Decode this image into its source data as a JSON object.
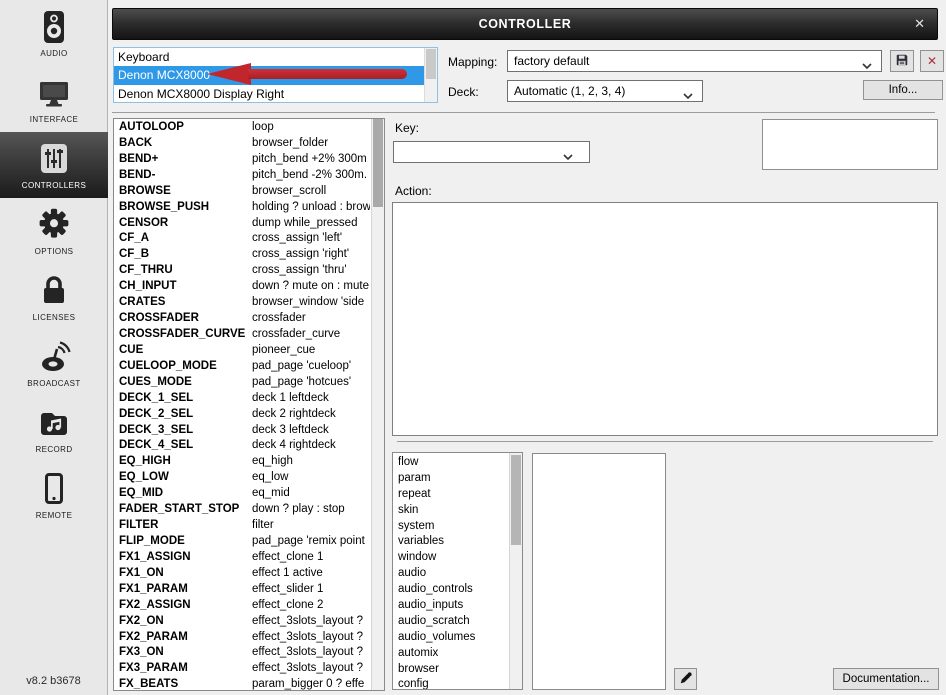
{
  "window": {
    "title": "CONTROLLER",
    "close_glyph": "✕"
  },
  "sidebar": {
    "items": [
      {
        "label": "AUDIO",
        "icon": "speaker-icon",
        "selected": false
      },
      {
        "label": "INTERFACE",
        "icon": "monitor-icon",
        "selected": false
      },
      {
        "label": "CONTROLLERS",
        "icon": "sliders-icon",
        "selected": true
      },
      {
        "label": "OPTIONS",
        "icon": "gear-icon",
        "selected": false
      },
      {
        "label": "LICENSES",
        "icon": "lock-icon",
        "selected": false
      },
      {
        "label": "BROADCAST",
        "icon": "broadcast-icon",
        "selected": false
      },
      {
        "label": "RECORD",
        "icon": "folder-music-icon",
        "selected": false
      },
      {
        "label": "REMOTE",
        "icon": "smartphone-icon",
        "selected": false
      }
    ],
    "version": "v8.2 b3678"
  },
  "devices": {
    "items": [
      "Keyboard",
      "Denon MCX8000",
      "Denon MCX8000 Display Right"
    ],
    "selected_index": 1
  },
  "header": {
    "mapping_label": "Mapping:",
    "mapping_value": "factory default",
    "deck_label": "Deck:",
    "deck_value": "Automatic (1, 2, 3, 4)",
    "info_button": "Info..."
  },
  "key_panel": {
    "key_label": "Key:",
    "key_value": "",
    "action_label": "Action:",
    "action_value": "",
    "display_value": ""
  },
  "bindings": [
    {
      "key": "AUTOLOOP",
      "action": "loop"
    },
    {
      "key": "BACK",
      "action": "browser_folder"
    },
    {
      "key": "BEND+",
      "action": "pitch_bend +2% 300m"
    },
    {
      "key": "BEND-",
      "action": "pitch_bend -2% 300m."
    },
    {
      "key": "BROWSE",
      "action": "browser_scroll"
    },
    {
      "key": "BROWSE_PUSH",
      "action": "holding ? unload : brow"
    },
    {
      "key": "CENSOR",
      "action": "dump while_pressed"
    },
    {
      "key": "CF_A",
      "action": "cross_assign 'left'"
    },
    {
      "key": "CF_B",
      "action": "cross_assign 'right'"
    },
    {
      "key": "CF_THRU",
      "action": "cross_assign 'thru'"
    },
    {
      "key": "CH_INPUT",
      "action": "down ? mute on : mute"
    },
    {
      "key": "CRATES",
      "action": "browser_window 'side"
    },
    {
      "key": "CROSSFADER",
      "action": "crossfader"
    },
    {
      "key": "CROSSFADER_CURVE",
      "action": "crossfader_curve"
    },
    {
      "key": "CUE",
      "action": "pioneer_cue"
    },
    {
      "key": "CUELOOP_MODE",
      "action": "pad_page 'cueloop'"
    },
    {
      "key": "CUES_MODE",
      "action": "pad_page 'hotcues'"
    },
    {
      "key": "DECK_1_SEL",
      "action": "deck 1 leftdeck"
    },
    {
      "key": "DECK_2_SEL",
      "action": "deck 2 rightdeck"
    },
    {
      "key": "DECK_3_SEL",
      "action": "deck 3 leftdeck"
    },
    {
      "key": "DECK_4_SEL",
      "action": "deck 4 rightdeck"
    },
    {
      "key": "EQ_HIGH",
      "action": "eq_high"
    },
    {
      "key": "EQ_LOW",
      "action": "eq_low"
    },
    {
      "key": "EQ_MID",
      "action": "eq_mid"
    },
    {
      "key": "FADER_START_STOP",
      "action": "down ? play : stop"
    },
    {
      "key": "FILTER",
      "action": "filter"
    },
    {
      "key": "FLIP_MODE",
      "action": "pad_page 'remix point"
    },
    {
      "key": "FX1_ASSIGN",
      "action": "effect_clone 1"
    },
    {
      "key": "FX1_ON",
      "action": "effect 1 active"
    },
    {
      "key": "FX1_PARAM",
      "action": "effect_slider 1"
    },
    {
      "key": "FX2_ASSIGN",
      "action": "effect_clone 2"
    },
    {
      "key": "FX2_ON",
      "action": "effect_3slots_layout ?"
    },
    {
      "key": "FX2_PARAM",
      "action": "effect_3slots_layout ?"
    },
    {
      "key": "FX3_ON",
      "action": "effect_3slots_layout ?"
    },
    {
      "key": "FX3_PARAM",
      "action": "effect_3slots_layout ?"
    },
    {
      "key": "FX_BEATS",
      "action": "param_bigger 0 ? effe"
    }
  ],
  "categories": [
    "flow",
    "param",
    "repeat",
    "skin",
    "system",
    "variables",
    "window",
    "audio",
    "audio_controls",
    "audio_inputs",
    "audio_scratch",
    "audio_volumes",
    "automix",
    "browser",
    "config"
  ],
  "footer": {
    "documentation_button": "Documentation..."
  },
  "colors": {
    "selection_blue": "#2f99e8",
    "arrow_red": "#c0262c",
    "titlebar_dark": "#2b2b2b",
    "sidebar_bg": "#e8e8e8",
    "panel_bg": "#f0f0f0",
    "close_red": "#a5333a"
  }
}
